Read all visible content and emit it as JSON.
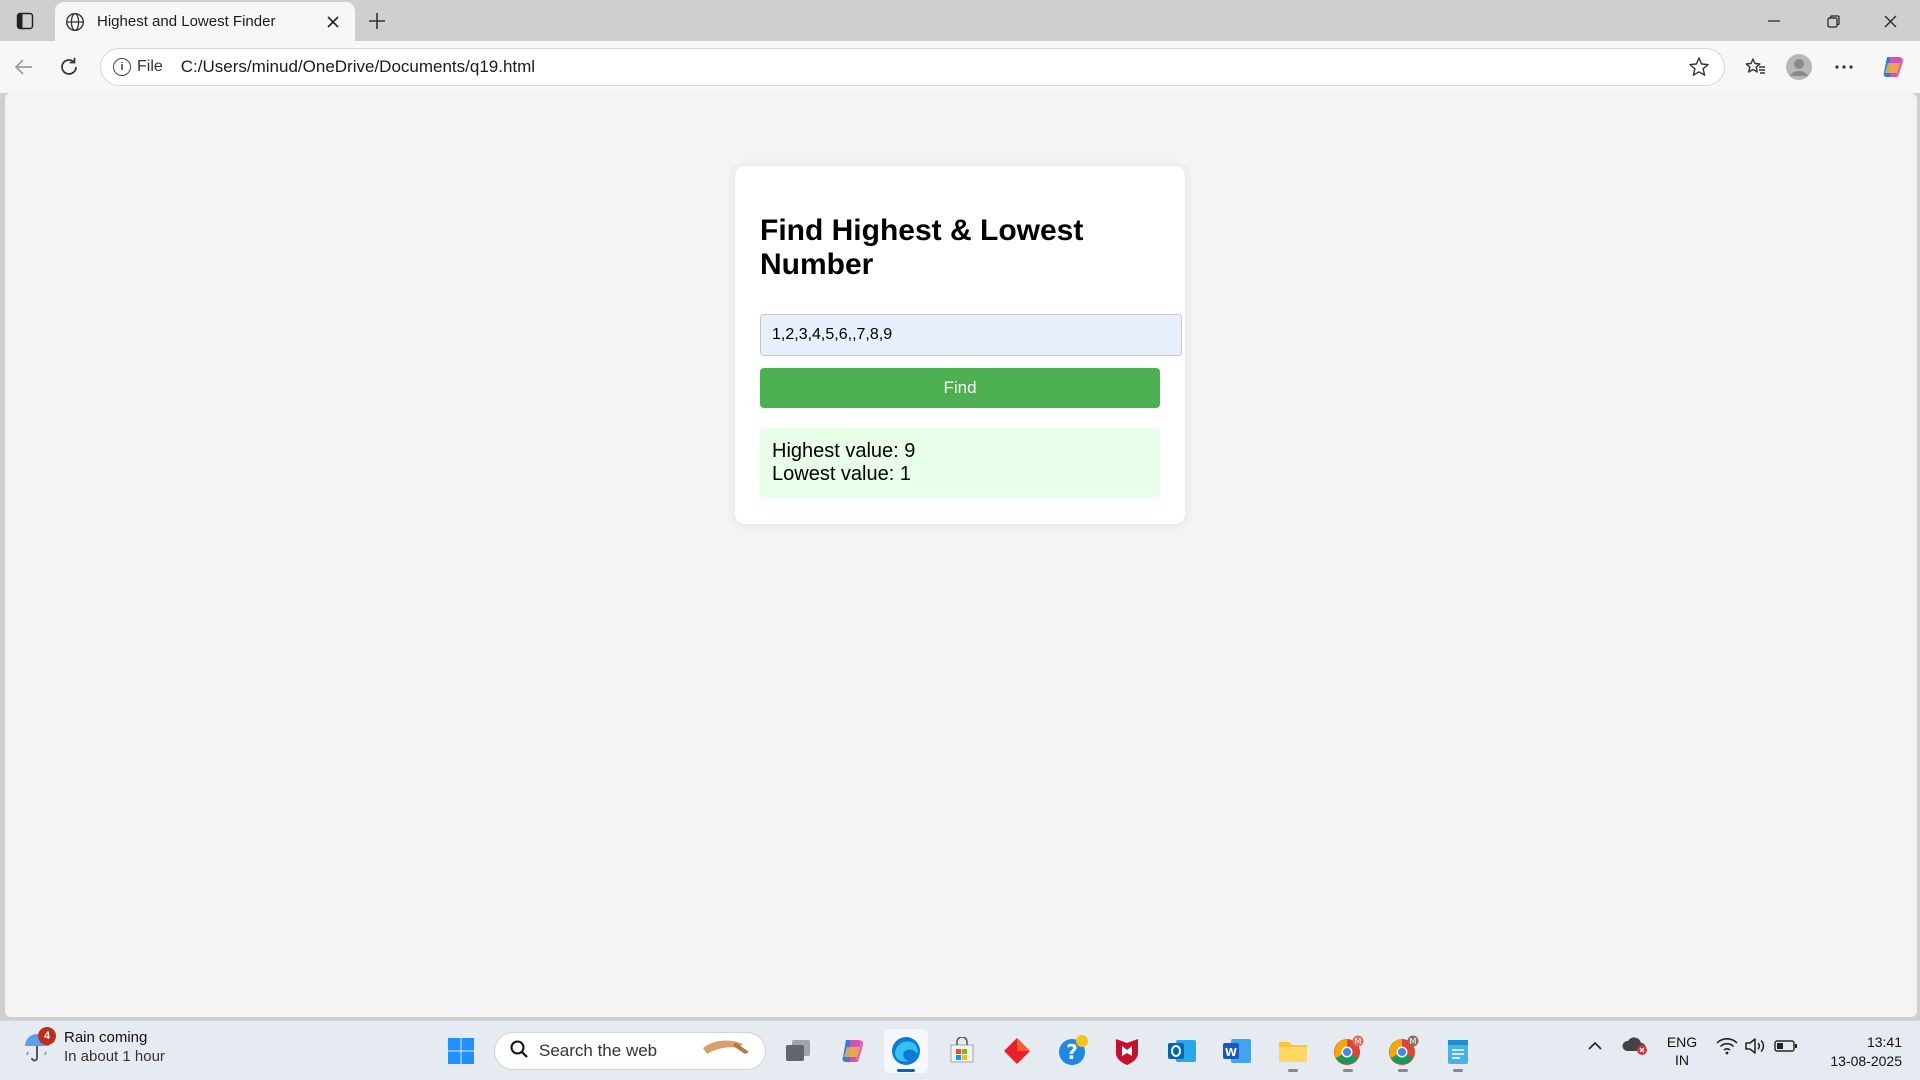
{
  "browser": {
    "tab_title": "Highest and Lowest Finder",
    "scheme_label": "File",
    "url": "C:/Users/minud/OneDrive/Documents/q19.html"
  },
  "page": {
    "heading": "Find Highest & Lowest Number",
    "input_value": "1,2,3,4,5,6,,7,8,9",
    "button_label": "Find",
    "result_highest": "Highest value: 9",
    "result_lowest": "Lowest value: 1"
  },
  "taskbar": {
    "weather_badge": "4",
    "weather_title": "Rain coming",
    "weather_sub": "In about 1 hour",
    "search_placeholder": "Search the web",
    "lang_line1": "ENG",
    "lang_line2": "IN",
    "time": "13:41",
    "date": "13-08-2025"
  },
  "colors": {
    "button_green": "#4caf50",
    "result_bg": "#e8ffe8",
    "input_bg": "#e8f0fe",
    "page_bg": "#f4f4f4"
  }
}
